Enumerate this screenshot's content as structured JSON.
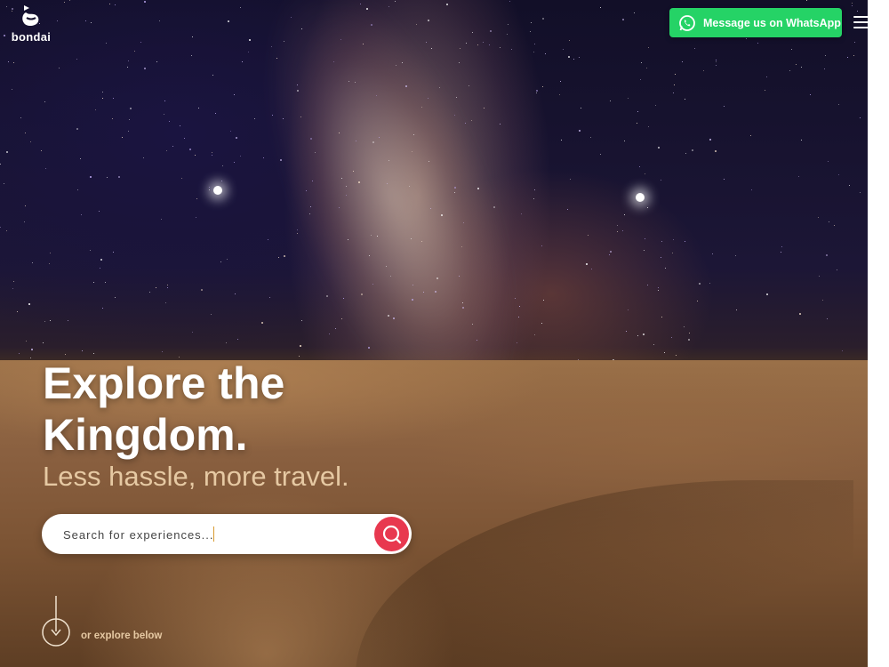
{
  "brand": {
    "name": "bondai",
    "logo_icon": "bondai-logo-icon"
  },
  "header": {
    "whatsapp_label": "Message us on WhatsApp",
    "whatsapp_icon": "whatsapp-icon",
    "menu_icon": "hamburger-menu-icon"
  },
  "hero": {
    "headline": "Explore the Kingdom.",
    "subheadline": "Less hassle, more travel."
  },
  "search": {
    "placeholder": "Search for experiences...",
    "button_icon": "search-icon"
  },
  "explore": {
    "label": "or explore below",
    "icon": "arrow-down-icon"
  },
  "colors": {
    "whatsapp_green": "#25d366",
    "search_button": "#e8384f",
    "subhead_tan": "#e6c9a3"
  }
}
